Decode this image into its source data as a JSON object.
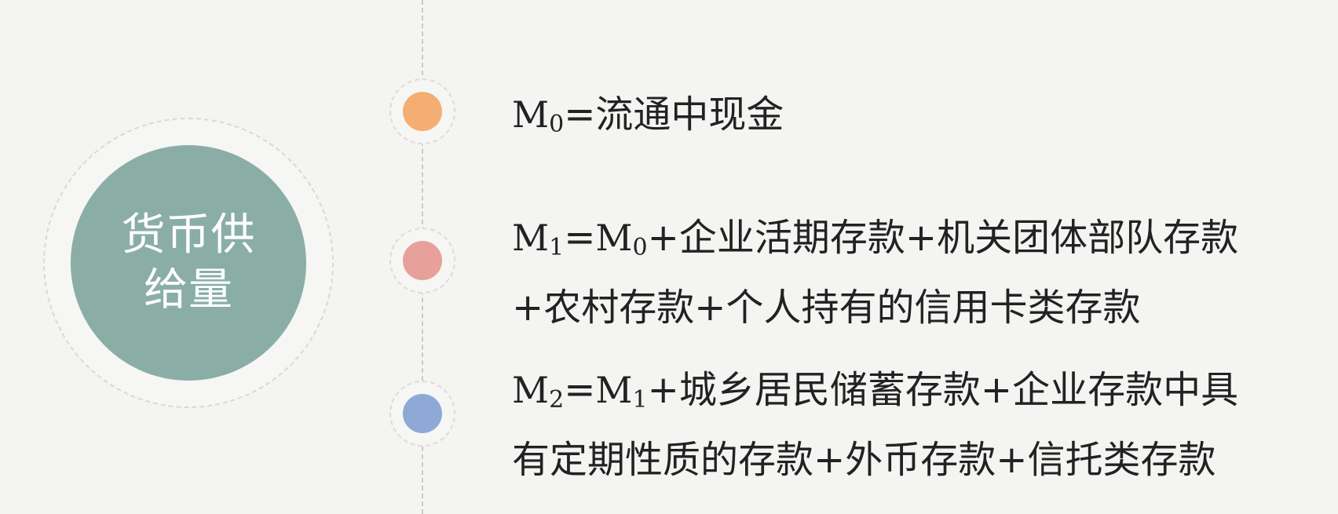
{
  "center": {
    "line1": "货币供",
    "line2": "给量"
  },
  "colors": {
    "hub": "#8aaea6",
    "dot_m0": "#f4ae73",
    "dot_m1": "#e8a09b",
    "dot_m2": "#8ea9d6"
  },
  "items": [
    {
      "dot_color": "#f4ae73",
      "symbol": "M",
      "subscript": "0",
      "line1_rest": "=流通中现金"
    },
    {
      "dot_color": "#e8a09b",
      "symbol": "M",
      "subscript": "1",
      "eq": "=",
      "ref_symbol": "M",
      "ref_subscript": "0",
      "line1_rest": "+企业活期存款+机关团体部队存款",
      "line2": "+农村存款+个人持有的信用卡类存款"
    },
    {
      "dot_color": "#8ea9d6",
      "symbol": "M",
      "subscript": "2",
      "eq": "=",
      "ref_symbol": "M",
      "ref_subscript": "1",
      "line1_rest": "+城乡居民储蓄存款+企业存款中具",
      "line2": "有定期性质的存款+外币存款+信托类存款"
    }
  ]
}
